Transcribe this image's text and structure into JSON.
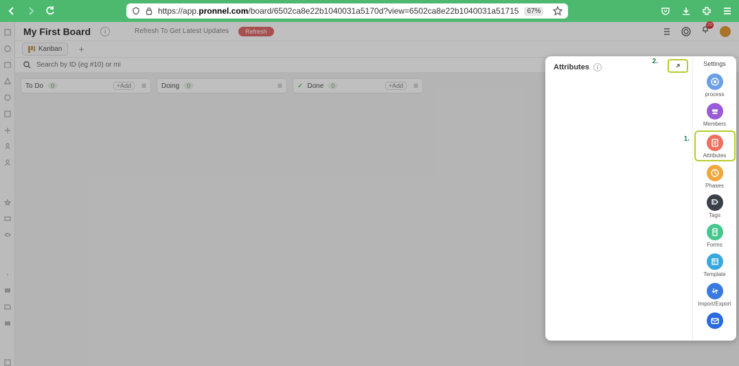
{
  "browser": {
    "url_prefix": "https://app.",
    "url_host": "pronnel.com",
    "url_path": "/board/6502ca8e22b1040031a5170d?view=6502ca8e22b1040031a51715",
    "zoom": "67%"
  },
  "header": {
    "board_title": "My First Board",
    "refresh_hint": "Refresh To Get Latest Updates",
    "refresh_btn": "Refresh",
    "bell_count": "20"
  },
  "tabs": {
    "kanban": "Kanban"
  },
  "search": {
    "placeholder": "Search by ID (eg #10) or mi"
  },
  "columns": [
    {
      "title": "To Do",
      "count": "0",
      "add": "+Add"
    },
    {
      "title": "Doing",
      "count": "0",
      "add": ""
    },
    {
      "title": "Done",
      "count": "0",
      "add": "+Add",
      "done": true
    }
  ],
  "panel": {
    "title": "Attributes",
    "callout1": "1.",
    "callout2": "2.",
    "settings_label": "Settings",
    "items": {
      "process": "process",
      "members": "Members",
      "attributes": "Attributes",
      "phases": "Phases",
      "tags": "Tags",
      "forms": "Forms",
      "template": "Template",
      "impexp": "Import/Export"
    }
  }
}
